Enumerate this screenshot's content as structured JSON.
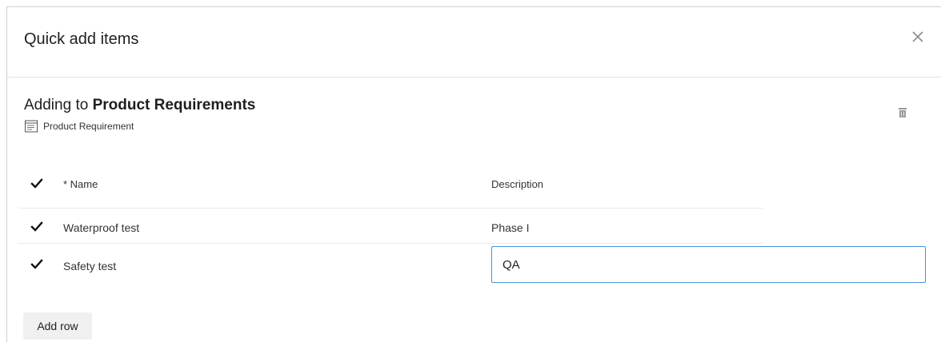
{
  "dialog": {
    "title": "Quick add items",
    "close_icon": "close-icon"
  },
  "context": {
    "adding_prefix": "Adding to",
    "target_name": "Product Requirements",
    "item_type": "Product Requirement",
    "type_icon": "requirement-icon",
    "delete_icon": "trash-icon"
  },
  "table": {
    "name_header": "* Name",
    "description_header": "Description",
    "rows": [
      {
        "checked": true,
        "name": "Waterproof test",
        "description": "Phase I"
      },
      {
        "checked": true,
        "name": "Safety test",
        "description": "QA"
      }
    ]
  },
  "actions": {
    "add_row_label": "Add row"
  },
  "colors": {
    "focus_border": "#4a90d9",
    "button_bg": "#f0f0f0"
  }
}
